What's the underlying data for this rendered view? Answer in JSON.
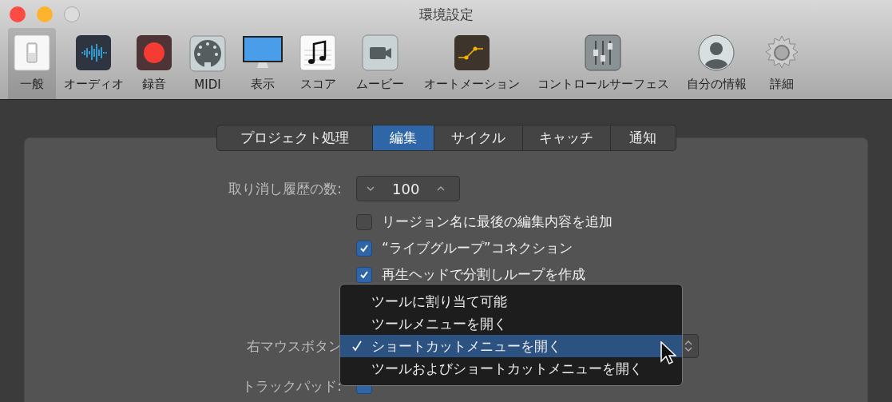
{
  "window": {
    "title": "環境設定"
  },
  "toolbar": [
    {
      "label": "一般",
      "selected": true
    },
    {
      "label": "オーディオ",
      "selected": false
    },
    {
      "label": "録音",
      "selected": false
    },
    {
      "label": "MIDI",
      "selected": false
    },
    {
      "label": "表示",
      "selected": false
    },
    {
      "label": "スコア",
      "selected": false
    },
    {
      "label": "ムービー",
      "selected": false
    },
    {
      "label": "オートメーション",
      "selected": false
    },
    {
      "label": "コントロールサーフェス",
      "selected": false
    },
    {
      "label": "自分の情報",
      "selected": false
    },
    {
      "label": "詳細",
      "selected": false
    }
  ],
  "tabs": [
    {
      "label": "プロジェクト処理",
      "selected": false
    },
    {
      "label": "編集",
      "selected": true
    },
    {
      "label": "サイクル",
      "selected": false
    },
    {
      "label": "キャッチ",
      "selected": false
    },
    {
      "label": "通知",
      "selected": false
    }
  ],
  "undo": {
    "label": "取り消し履歴の数:",
    "value": "100"
  },
  "options": [
    {
      "label": "リージョン名に最後の編集内容を追加",
      "checked": false
    },
    {
      "label": "“ライブグループ”コネクション",
      "checked": true
    },
    {
      "label": "再生ヘッドで分割しループを作成",
      "checked": true
    }
  ],
  "right_mouse": {
    "label": "右マウスボタン"
  },
  "menu": [
    {
      "label": "ツールに割り当て可能",
      "selected": false
    },
    {
      "label": "ツールメニューを開く",
      "selected": false
    },
    {
      "label": "ショートカットメニューを開く",
      "selected": true
    },
    {
      "label": "ツールおよびショートカットメニューを開く",
      "selected": false
    }
  ],
  "trackpad": {
    "label": "トラックパッド:",
    "checked": true
  }
}
